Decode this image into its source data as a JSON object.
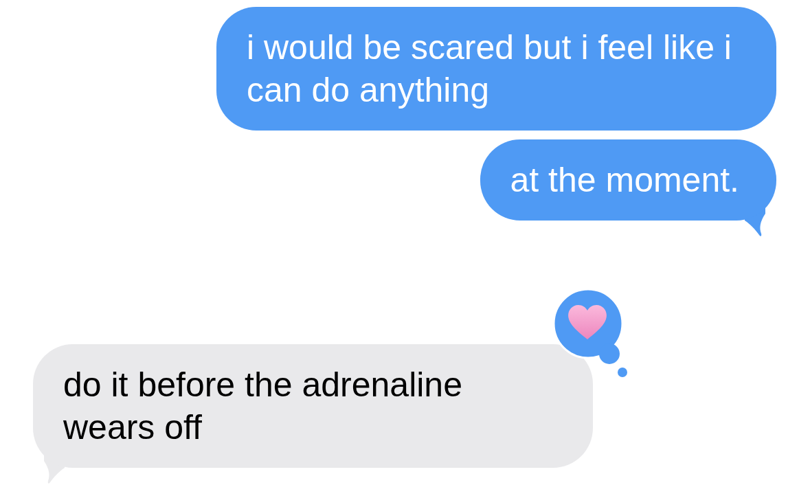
{
  "messages": [
    {
      "kind": "sent",
      "text": "i would be scared but i feel like i can do anything",
      "tail": false
    },
    {
      "kind": "sent",
      "text": "at the moment.",
      "tail": true
    },
    {
      "kind": "received",
      "text": "do it before the adrenaline wears off",
      "tail": true,
      "reaction": {
        "kind": "heart"
      }
    }
  ]
}
